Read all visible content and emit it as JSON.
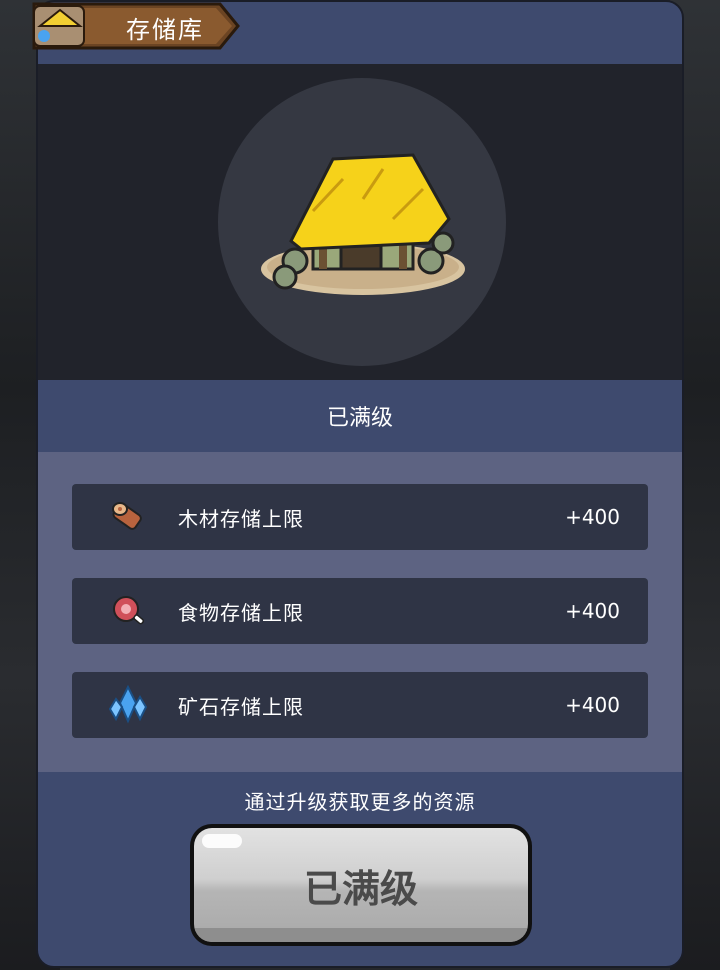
{
  "header": {
    "title": "存储库"
  },
  "building": {
    "status": "已满级"
  },
  "stats": [
    {
      "icon": "wood-log-icon",
      "label": "木材存储上限",
      "value": "+400"
    },
    {
      "icon": "meat-icon",
      "label": "食物存储上限",
      "value": "+400"
    },
    {
      "icon": "crystal-ore-icon",
      "label": "矿石存储上限",
      "value": "+400"
    }
  ],
  "hint": "通过升级获取更多的资源",
  "upgrade_button": {
    "label": "已满级"
  }
}
